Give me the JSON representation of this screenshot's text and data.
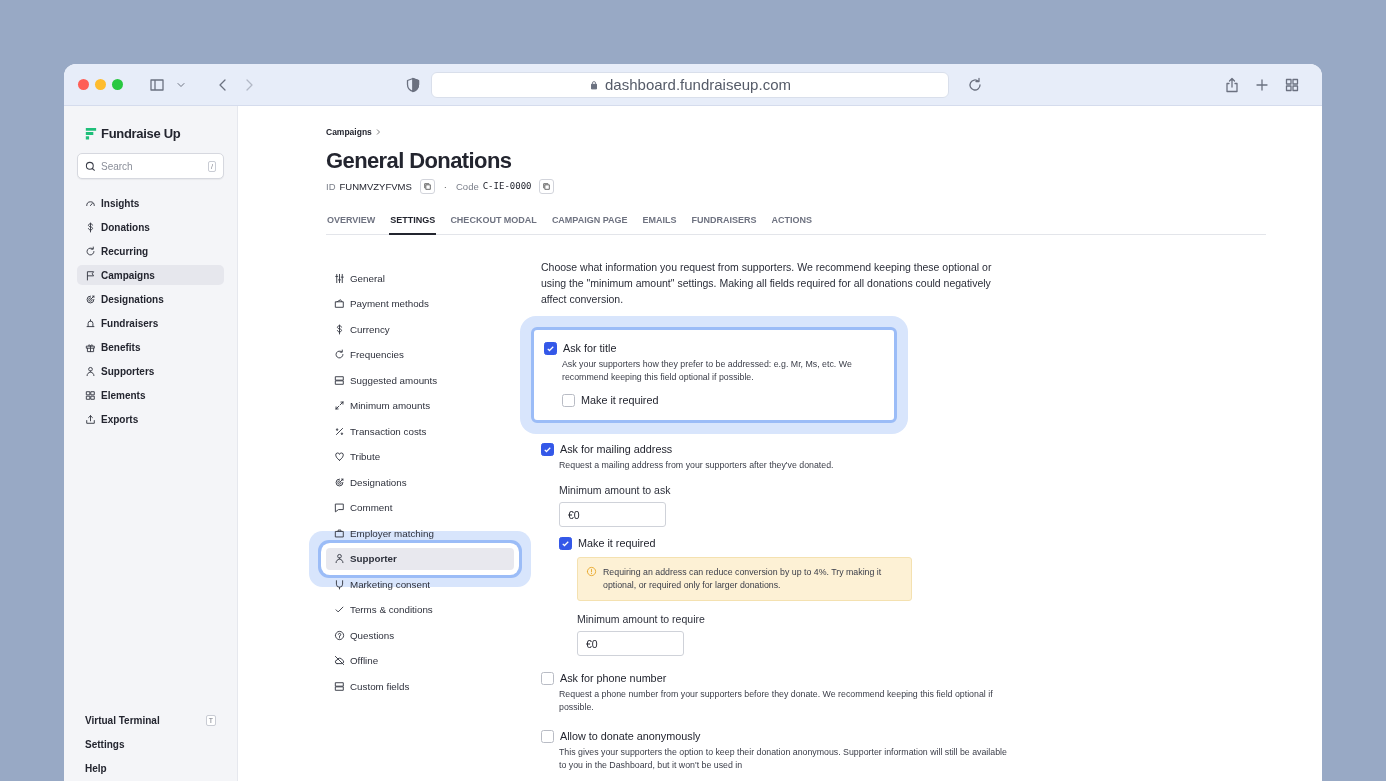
{
  "browser": {
    "url": "dashboard.fundraiseup.com"
  },
  "sidebar": {
    "logo": "Fundraise Up",
    "search": {
      "placeholder": "Search",
      "shortcut": "/"
    },
    "items": [
      {
        "label": "Insights",
        "selected": false
      },
      {
        "label": "Donations",
        "selected": false
      },
      {
        "label": "Recurring",
        "selected": false
      },
      {
        "label": "Campaigns",
        "selected": true
      },
      {
        "label": "Designations",
        "selected": false
      },
      {
        "label": "Fundraisers",
        "selected": false
      },
      {
        "label": "Benefits",
        "selected": false
      },
      {
        "label": "Supporters",
        "selected": false
      },
      {
        "label": "Elements",
        "selected": false
      },
      {
        "label": "Exports",
        "selected": false
      }
    ],
    "footer_items": [
      {
        "label": "Virtual Terminal",
        "shortcut": "T"
      },
      {
        "label": "Settings"
      },
      {
        "label": "Help"
      }
    ]
  },
  "page": {
    "breadcrumb": "Campaigns",
    "title": "General Donations",
    "id_label": "ID",
    "id_value": "FUNMVZYFVMS",
    "separator": "·",
    "code_label": "Code",
    "code_value": "C-IE-0000",
    "tabs": [
      {
        "label": "OVERVIEW",
        "selected": false
      },
      {
        "label": "SETTINGS",
        "selected": true
      },
      {
        "label": "CHECKOUT MODAL",
        "selected": false
      },
      {
        "label": "CAMPAIGN PAGE",
        "selected": false
      },
      {
        "label": "EMAILS",
        "selected": false
      },
      {
        "label": "FUNDRAISERS",
        "selected": false
      },
      {
        "label": "ACTIONS",
        "selected": false
      }
    ]
  },
  "settings_nav": [
    {
      "label": "General",
      "selected": false,
      "highlighted": false
    },
    {
      "label": "Payment methods",
      "selected": false,
      "highlighted": false
    },
    {
      "label": "Currency",
      "selected": false,
      "highlighted": false
    },
    {
      "label": "Frequencies",
      "selected": false,
      "highlighted": false
    },
    {
      "label": "Suggested amounts",
      "selected": false,
      "highlighted": false
    },
    {
      "label": "Minimum amounts",
      "selected": false,
      "highlighted": false
    },
    {
      "label": "Transaction costs",
      "selected": false,
      "highlighted": false
    },
    {
      "label": "Tribute",
      "selected": false,
      "highlighted": false
    },
    {
      "label": "Designations",
      "selected": false,
      "highlighted": false
    },
    {
      "label": "Comment",
      "selected": false,
      "highlighted": false
    },
    {
      "label": "Employer matching",
      "selected": false,
      "highlighted": false
    },
    {
      "label": "Supporter",
      "selected": true,
      "highlighted": true
    },
    {
      "label": "Marketing consent",
      "selected": false,
      "highlighted": false
    },
    {
      "label": "Terms & conditions",
      "selected": false,
      "highlighted": false
    },
    {
      "label": "Questions",
      "selected": false,
      "highlighted": false
    },
    {
      "label": "Offline",
      "selected": false,
      "highlighted": false
    },
    {
      "label": "Custom fields",
      "selected": false,
      "highlighted": false
    }
  ],
  "intro": "Choose what information you request from supporters. We recommend keeping these optional or using the \"minimum amount\" settings. Making all fields required for all donations could negatively affect conversion.",
  "options": [
    {
      "label": "Ask for title",
      "checked": true,
      "highlighted": true,
      "description": "Ask your supporters how they prefer to be addressed: e.g. Mr, Ms, etc. We recommend keeping this field optional if possible.",
      "required": {
        "label": "Make it required",
        "checked": false
      }
    },
    {
      "label": "Ask for mailing address",
      "checked": true,
      "highlighted": false,
      "description": "Request a mailing address from your supporters after they've donated.",
      "min_ask": {
        "label": "Minimum amount to ask",
        "value": "€0"
      },
      "required": {
        "label": "Make it required",
        "checked": true
      },
      "warning": "Requiring an address can reduce conversion by up to 4%. Try making it optional, or required only for larger donations.",
      "min_require": {
        "label": "Minimum amount to require",
        "value": "€0"
      }
    },
    {
      "label": "Ask for phone number",
      "checked": false,
      "highlighted": false,
      "description": "Request a phone number from your supporters before they donate. We recommend keeping this field optional if possible."
    },
    {
      "label": "Allow to donate anonymously",
      "checked": false,
      "highlighted": false,
      "description": "This gives your supporters the option to keep their donation anonymous. Supporter information will still be available to you in the Dashboard, but it won't be used in"
    }
  ]
}
